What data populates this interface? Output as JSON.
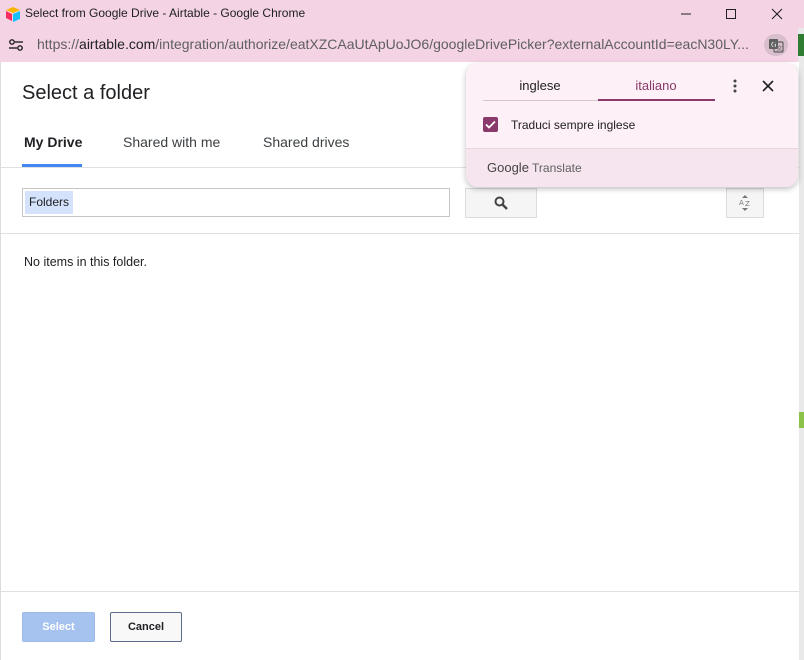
{
  "window": {
    "title": "Select from Google Drive - Airtable - Google Chrome"
  },
  "addressbar": {
    "url_prefix": "https://",
    "url_domain": "airtable.com",
    "url_path": "/integration/authorize/eatXZCAaUtApUoJO6/googleDrivePicker?externalAccountId=eacN30LY..."
  },
  "picker": {
    "title": "Select a folder",
    "tabs": [
      {
        "label": "My Drive",
        "selected": true
      },
      {
        "label": "Shared with me",
        "selected": false
      },
      {
        "label": "Shared drives",
        "selected": false
      }
    ],
    "search": {
      "chip": "Folders",
      "value": ""
    },
    "empty_message": "No items in this folder.",
    "select_label": "Select",
    "cancel_label": "Cancel"
  },
  "translate_popup": {
    "source_language": "inglese",
    "target_language": "italiano",
    "always_translate_label": "Traduci sempre inglese",
    "always_translate_checked": true,
    "brand_google": "Google",
    "brand_translate": "Translate"
  },
  "colors": {
    "chrome_frame": "#f4d3e5",
    "accent_blue": "#4285f4",
    "translate_accent": "#8a3a6a",
    "select_disabled": "#a6c3ef"
  },
  "icons": {
    "app": "airtable-logo",
    "minimize": "minimize-icon",
    "maximize": "maximize-icon",
    "close": "close-icon",
    "site_info": "tune-icon",
    "translate": "translate-icon",
    "search": "search-icon",
    "sort": "sort-az-icon",
    "more": "more-vert-icon",
    "check": "check-icon"
  }
}
